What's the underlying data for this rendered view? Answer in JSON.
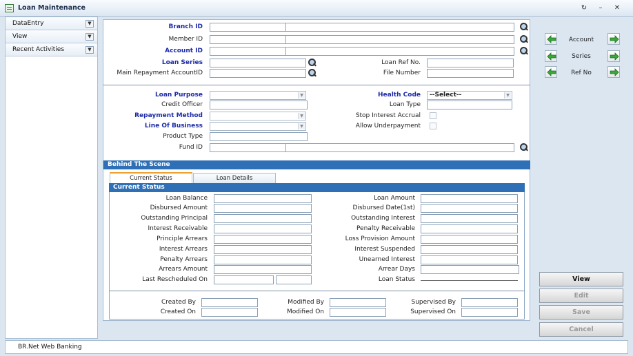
{
  "window": {
    "title": "Loan Maintenance"
  },
  "sidebar": {
    "items": [
      {
        "label": "DataEntry"
      },
      {
        "label": "View"
      },
      {
        "label": "Recent Activities"
      }
    ]
  },
  "top": {
    "branch_id": "Branch ID",
    "member_id": "Member ID",
    "account_id": "Account ID",
    "loan_series": "Loan Series",
    "main_repayment": "Main Repayment AccountID",
    "loan_ref": "Loan Ref No.",
    "file_number": "File Number"
  },
  "mid": {
    "loan_purpose": "Loan Purpose",
    "credit_officer": "Credit Officer",
    "repayment_method": "Repayment Method",
    "line_of_business": "Line Of Business",
    "product_type": "Product Type",
    "fund_id": "Fund ID",
    "health_code": "Health Code",
    "health_code_value": "--Select--",
    "loan_type": "Loan Type",
    "stop_interest": "Stop Interest Accrual",
    "allow_underpayment": "Allow Underpayment"
  },
  "behind": {
    "header": "Behind The Scene",
    "tabs": [
      "Current Status",
      "Loan Details"
    ],
    "current_status_header": "Current Status",
    "left": [
      "Loan Balance",
      "Disbursed Amount",
      "Outstanding Principal",
      "Interest Receivable",
      "Principle Arrears",
      "Interest Arrears",
      "Penalty Arrears",
      "Arrears Amount",
      "Last Rescheduled On"
    ],
    "right": [
      "Loan Amount",
      "Disbursed Date(1st)",
      "Outstanding Interest",
      "Penalty Receivable",
      "Loss Provision Amount",
      "Interest Suspended",
      "Unearned Interest",
      "Arrear Days",
      "Loan Status"
    ],
    "audit": {
      "created_by": "Created By",
      "created_on": "Created On",
      "modified_by": "Modified By",
      "modified_on": "Modified On",
      "supervised_by": "Supervised By",
      "supervised_on": "Supervised On"
    }
  },
  "nav": {
    "account": "Account",
    "series": "Series",
    "ref_no": "Ref No"
  },
  "actions": {
    "view": "View",
    "edit": "Edit",
    "save": "Save",
    "cancel": "Cancel"
  },
  "status": {
    "text": "BR.Net Web Banking"
  }
}
